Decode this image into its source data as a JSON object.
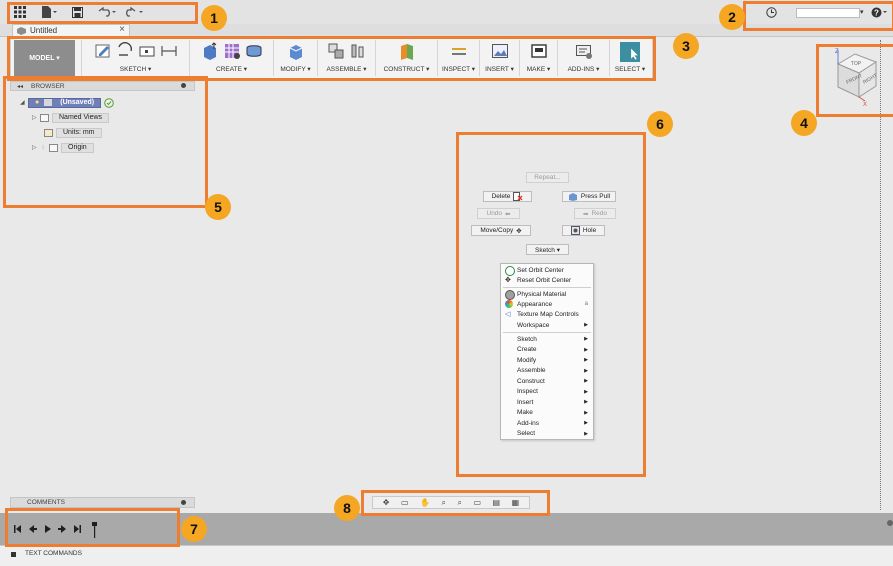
{
  "topbar": {
    "icons": [
      "app-grid-icon",
      "file-icon",
      "save-icon",
      "undo-icon",
      "redo-icon"
    ],
    "right_icons": [
      "clock-icon",
      "help-icon"
    ]
  },
  "tab": {
    "title": "Untitled",
    "close": "×"
  },
  "toolbar": {
    "workspace": "MODEL ▾",
    "groups": [
      {
        "label": "SKETCH ▾"
      },
      {
        "label": "CREATE ▾"
      },
      {
        "label": "MODIFY ▾"
      },
      {
        "label": "ASSEMBLE ▾"
      },
      {
        "label": "CONSTRUCT ▾"
      },
      {
        "label": "INSPECT ▾"
      },
      {
        "label": "INSERT ▾"
      },
      {
        "label": "MAKE ▾"
      },
      {
        "label": "ADD-INS ▾"
      },
      {
        "label": "SELECT ▾"
      }
    ]
  },
  "viewcube": {
    "top": "TOP",
    "front": "FRONT",
    "right": "RIGHT",
    "z": "Z",
    "x": "X"
  },
  "browser": {
    "header": "BROWSER",
    "collapse": "◂◂",
    "root": "(Unsaved)",
    "items": [
      "Named Views",
      "Units: mm",
      "Origin"
    ]
  },
  "marking_menu": {
    "repeat": "Repeat...",
    "delete": "Delete",
    "press_pull": "Press Pull",
    "undo": "Undo",
    "redo": "Redo",
    "move_copy": "Move/Copy",
    "hole": "Hole",
    "sketch": "Sketch ▾"
  },
  "context_menu": {
    "group1": [
      "Set Orbit Center",
      "Reset Orbit Center"
    ],
    "group2": [
      "Physical Material",
      "Appearance",
      "Texture Map Controls",
      "Workspace"
    ],
    "group3": [
      "Sketch",
      "Create",
      "Modify",
      "Assemble",
      "Construct",
      "Inspect",
      "Insert",
      "Make",
      "Add-ins",
      "Select"
    ],
    "appearance_shortcut": "a",
    "arrow": "▶"
  },
  "comments": {
    "label": "COMMENTS"
  },
  "text_commands": {
    "label": "TEXT COMMANDS"
  },
  "callouts": [
    "1",
    "2",
    "3",
    "4",
    "5",
    "6",
    "7",
    "8"
  ],
  "colors": {
    "callout_border": "#ed7d31",
    "callout_badge": "#f5a623",
    "selection": "#6f7fb8",
    "select_tool": "#3c8fa0"
  }
}
